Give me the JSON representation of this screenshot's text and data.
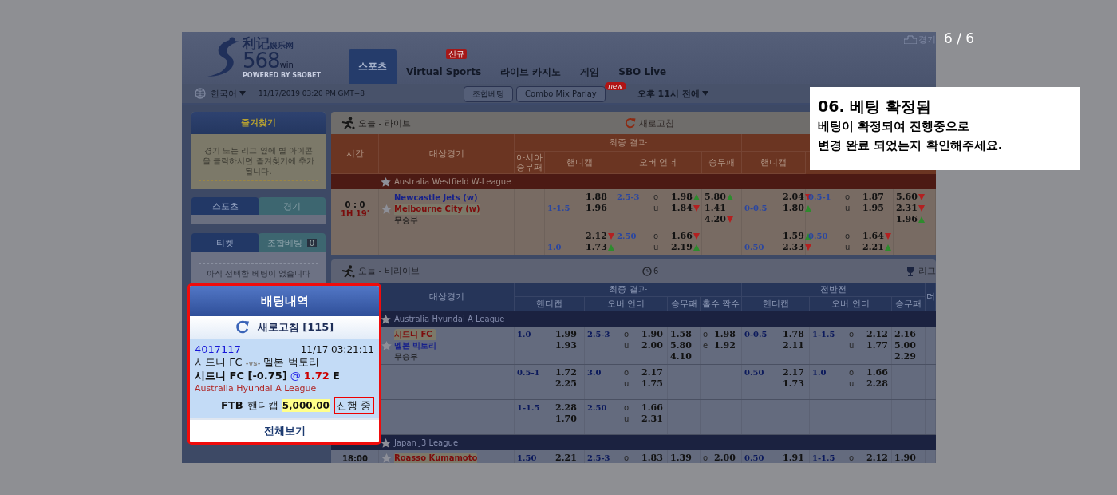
{
  "counter": "6 / 6",
  "caption": {
    "title": "06. 베팅 확정됨",
    "lines": [
      "베팅이 확정되여 진행중으로",
      "변경 완료 되었는지 확인해주세요."
    ]
  },
  "screenshot": {
    "logo": {
      "name": "利记",
      "sub": "娱乐网",
      "number": "568",
      "suffix": "win",
      "tagline": "POWERED BY SBOBET"
    },
    "nav": [
      {
        "label": "스포츠",
        "selected": true
      },
      {
        "label": "Virtual Sports",
        "selected": false,
        "badge": "신규"
      },
      {
        "label": "라이브 카지노",
        "selected": false
      },
      {
        "label": "게임",
        "selected": false
      },
      {
        "label": "SBO Live",
        "selected": false
      }
    ],
    "top_link": "경기",
    "toolbar": {
      "language": "한국어",
      "datetime": "11/17/2019 03:20 PM GMT+8",
      "buttons": [
        {
          "label": "조합베팅"
        },
        {
          "label": "Combo Mix Parlay",
          "badge": "new"
        }
      ],
      "time_filter": "오후 11시 전에"
    },
    "favorites": {
      "title": "즐겨찾기",
      "hint": "경기 또는 리그 옆에 별 아이콘을 클릭하시면 즐겨찾기에 추가됩니다."
    },
    "sport_tabs": [
      {
        "label": "스포츠",
        "selected": true
      },
      {
        "label": "경기",
        "selected": false
      }
    ],
    "ticket_tabs": [
      {
        "label": "티켓",
        "selected": true
      },
      {
        "label": "조합베팅",
        "selected": false,
        "count": "0"
      }
    ],
    "ticket_empty": "아직 선택한 베팅이 없습니다",
    "bet_panel": {
      "title": "배팅내역",
      "refresh": "새로고침 [115]",
      "view_all": "전체보기",
      "bet": {
        "id": "4017117",
        "time": "11/17 03:21:11",
        "home": "시드니 FC",
        "vs": "-vs-",
        "away": "멜본 벅토리",
        "selection": "시드니 FC [-0.75]",
        "at": "@",
        "odds": "1.72",
        "odds_type": "E",
        "league": "Australia Hyundai A League",
        "market_code": "FTB",
        "market": "핸디캡",
        "stake": "5,000.00",
        "status": "진행 중"
      }
    },
    "sections": [
      {
        "kind": "live",
        "title": "오늘 - 라이브",
        "refresh": "새로고침",
        "headers": {
          "time": "시간",
          "event": "대상경기",
          "full_time": "최종 결과",
          "full_time_columns": [
            "아시아 승무패",
            "핸디캡",
            "오버 언더",
            "승무패"
          ],
          "first_half_columns": [
            "핸디캡"
          ]
        },
        "leagues": [
          {
            "name": "Australia Westfield W-League",
            "matches": [
              {
                "score": "0 : 0",
                "clock": "1H 19'",
                "home": {
                  "name": "Newcastle Jets (w)",
                  "favorite": false
                },
                "away": {
                  "name": "Melbourne City (w)",
                  "favorite": true
                },
                "draw": "무승부",
                "lines": [
                  {
                    "ft_handicap": {
                      "line": "1-1.5",
                      "odds": [
                        {
                          "v": "1.88"
                        },
                        {
                          "v": "1.96"
                        }
                      ]
                    },
                    "ft_over_under": {
                      "line": "2.5-3",
                      "odds": [
                        {
                          "mark": "o",
                          "v": "1.98",
                          "up": true
                        },
                        {
                          "mark": "u",
                          "v": "1.84",
                          "up": false
                        }
                      ]
                    },
                    "ft_1x2": [
                      {
                        "v": "5.80",
                        "up": true
                      },
                      {
                        "v": "1.41"
                      },
                      {
                        "v": "4.20",
                        "up": false
                      }
                    ],
                    "fh_handicap": {
                      "line": "0-0.5",
                      "odds": [
                        {
                          "v": "2.04",
                          "up": false
                        },
                        {
                          "v": "1.80",
                          "up": true
                        }
                      ]
                    },
                    "fh_over_under": {
                      "line": "0.5-1",
                      "odds": [
                        {
                          "mark": "o",
                          "v": "1.87"
                        },
                        {
                          "mark": "u",
                          "v": "1.95"
                        }
                      ]
                    },
                    "fh_1x2": [
                      {
                        "v": "5.60",
                        "up": false
                      },
                      {
                        "v": "2.31",
                        "up": false
                      },
                      {
                        "v": "1.96",
                        "up": true
                      }
                    ]
                  },
                  {
                    "ft_handicap": {
                      "line": "1.0",
                      "odds": [
                        {
                          "v": "2.12",
                          "up": false
                        },
                        {
                          "v": "1.73",
                          "up": true
                        }
                      ]
                    },
                    "ft_over_under": {
                      "line": "2.50",
                      "odds": [
                        {
                          "mark": "o",
                          "v": "1.66",
                          "up": false
                        },
                        {
                          "mark": "u",
                          "v": "2.19",
                          "up": true
                        }
                      ]
                    },
                    "fh_handicap": {
                      "line": "0.50",
                      "odds": [
                        {
                          "v": "1.59",
                          "up": true
                        },
                        {
                          "v": "2.33",
                          "up": false
                        }
                      ]
                    },
                    "fh_over_under": {
                      "line": "0.50",
                      "odds": [
                        {
                          "mark": "o",
                          "v": "1.64",
                          "up": false
                        },
                        {
                          "mark": "u",
                          "v": "2.21",
                          "up": true
                        }
                      ]
                    }
                  }
                ]
              }
            ]
          }
        ]
      },
      {
        "kind": "upcoming",
        "title": "오늘 - 비라이브",
        "count": "6",
        "right_link": "리그",
        "headers": {
          "event": "대상경기",
          "full_time": "최종 결과",
          "full_time_columns": [
            "핸디캡",
            "오버 언더",
            "승무패",
            "홀수 짝수"
          ],
          "first_half": "전반전",
          "first_half_columns": [
            "핸디캡",
            "오버 언더",
            "승무패"
          ],
          "more": "더"
        },
        "leagues": [
          {
            "name": "Australia Hyundai A League",
            "matches": [
              {
                "home": {
                  "name": "시드니 FC",
                  "favorite": true
                },
                "away": {
                  "name": "멜본 빅토리",
                  "favorite": false
                },
                "draw": "무승부",
                "lines": [
                  {
                    "ft_handicap": {
                      "line": "1.0",
                      "odds": [
                        {
                          "v": "1.99"
                        },
                        {
                          "v": "1.93"
                        }
                      ]
                    },
                    "ft_over_under": {
                      "line": "2.5-3",
                      "odds": [
                        {
                          "mark": "o",
                          "v": "1.90"
                        },
                        {
                          "mark": "u",
                          "v": "2.00"
                        }
                      ]
                    },
                    "ft_1x2": [
                      {
                        "v": "1.58"
                      },
                      {
                        "v": "5.80"
                      },
                      {
                        "v": "4.10"
                      }
                    ],
                    "ft_odd_even": {
                      "odds": [
                        {
                          "mark": "o",
                          "v": "1.98"
                        },
                        {
                          "mark": "e",
                          "v": "1.92"
                        }
                      ]
                    },
                    "fh_handicap": {
                      "line": "0-0.5",
                      "odds": [
                        {
                          "v": "1.78"
                        },
                        {
                          "v": "2.11"
                        }
                      ]
                    },
                    "fh_over_under": {
                      "line": "1-1.5",
                      "odds": [
                        {
                          "mark": "o",
                          "v": "2.12"
                        },
                        {
                          "mark": "u",
                          "v": "1.77"
                        }
                      ]
                    },
                    "fh_1x2": [
                      {
                        "v": "2.16"
                      },
                      {
                        "v": "5.00"
                      },
                      {
                        "v": "2.29"
                      }
                    ]
                  },
                  {
                    "ft_handicap": {
                      "line": "0.5-1",
                      "odds": [
                        {
                          "v": "1.72"
                        },
                        {
                          "v": "2.25"
                        }
                      ]
                    },
                    "ft_over_under": {
                      "line": "3.0",
                      "odds": [
                        {
                          "mark": "o",
                          "v": "2.17"
                        },
                        {
                          "mark": "u",
                          "v": "1.75"
                        }
                      ]
                    },
                    "fh_handicap": {
                      "line": "0.50",
                      "odds": [
                        {
                          "v": "2.17"
                        },
                        {
                          "v": "1.73"
                        }
                      ]
                    },
                    "fh_over_under": {
                      "line": "1.0",
                      "odds": [
                        {
                          "mark": "o",
                          "v": "1.66"
                        },
                        {
                          "mark": "u",
                          "v": "2.28"
                        }
                      ]
                    }
                  },
                  {
                    "ft_handicap": {
                      "line": "1-1.5",
                      "odds": [
                        {
                          "v": "2.28"
                        },
                        {
                          "v": "1.70"
                        }
                      ]
                    },
                    "ft_over_under": {
                      "line": "2.50",
                      "odds": [
                        {
                          "mark": "o",
                          "v": "1.66"
                        },
                        {
                          "mark": "u",
                          "v": "2.31"
                        }
                      ]
                    }
                  }
                ]
              }
            ]
          },
          {
            "name": "Japan J3 League",
            "matches": [
              {
                "kickoff": "18:00",
                "home": {
                  "name": "Roasso Kumamoto",
                  "favorite": true
                },
                "lines": [
                  {
                    "ft_handicap": {
                      "line": "1.50",
                      "odds": [
                        {
                          "v": "2.21"
                        }
                      ]
                    },
                    "ft_over_under": {
                      "line": "2.5-3",
                      "odds": [
                        {
                          "mark": "o",
                          "v": "1.83"
                        }
                      ]
                    },
                    "ft_1x2": [
                      {
                        "v": "1.39"
                      }
                    ],
                    "ft_odd_even": {
                      "odds": [
                        {
                          "mark": "o",
                          "v": "2.00"
                        }
                      ]
                    },
                    "fh_handicap": {
                      "line": "0.50",
                      "odds": [
                        {
                          "v": "1.91"
                        }
                      ]
                    },
                    "fh_over_under": {
                      "line": "1-1.5",
                      "odds": [
                        {
                          "mark": "o",
                          "v": "2.12"
                        }
                      ]
                    },
                    "fh_1x2": [
                      {
                        "v": "1.90"
                      }
                    ]
                  }
                ]
              }
            ]
          }
        ]
      }
    ]
  }
}
